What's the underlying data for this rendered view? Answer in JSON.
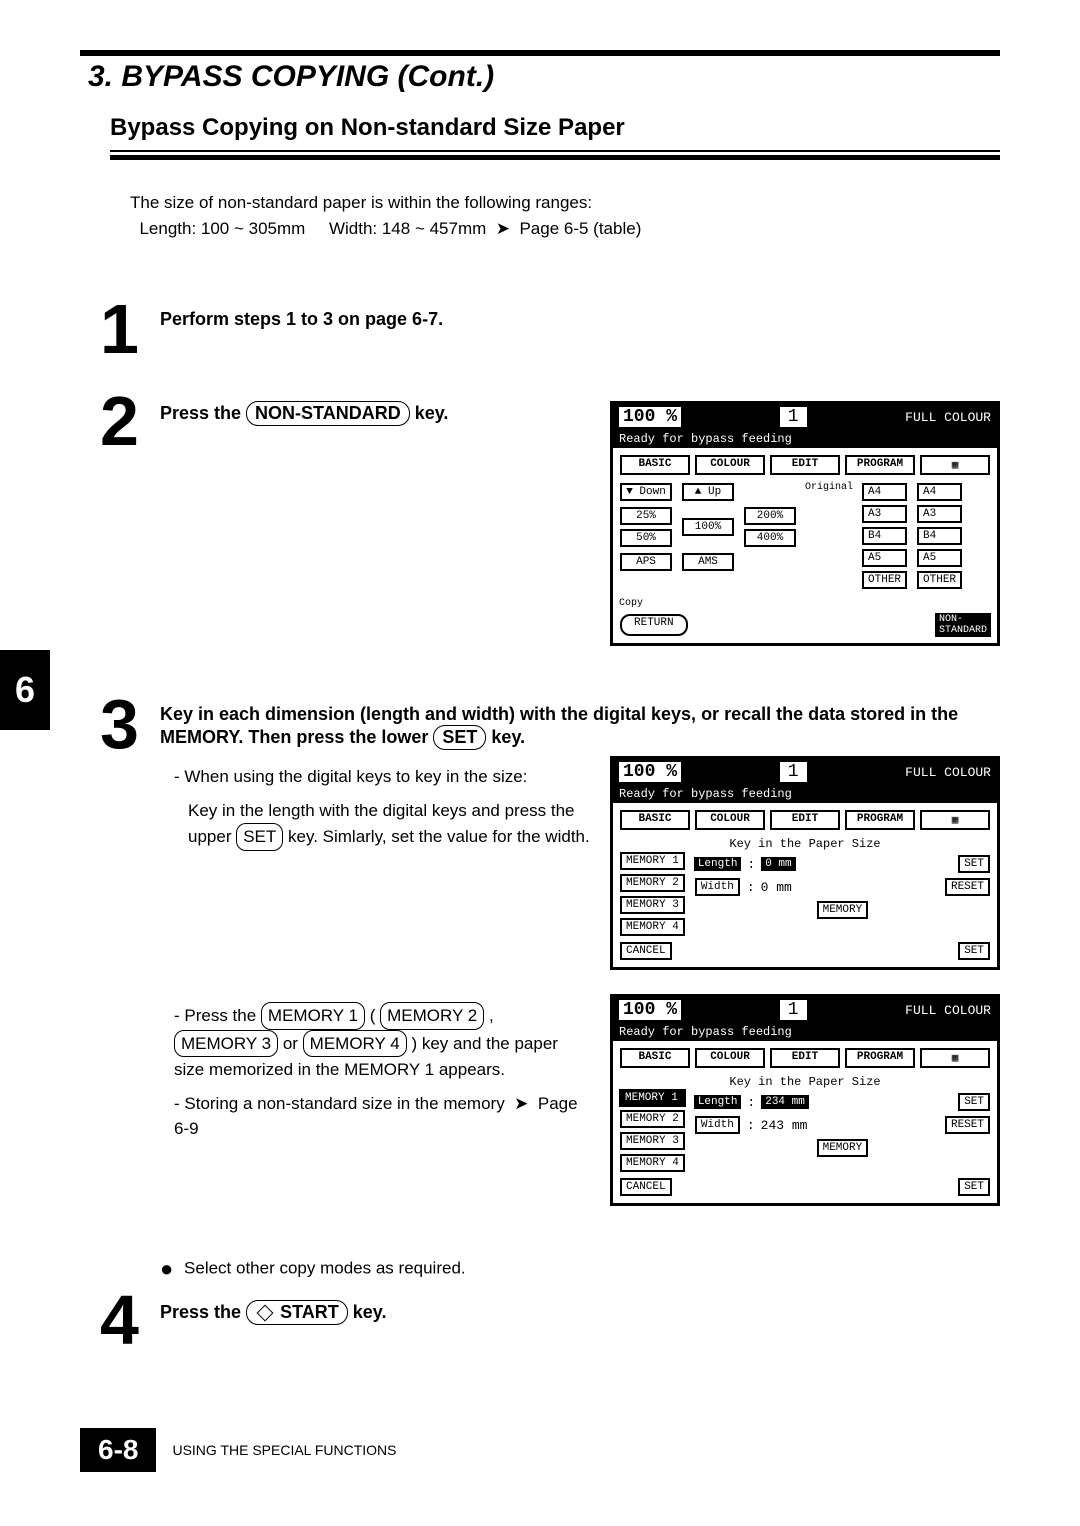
{
  "header": {
    "title": "3. BYPASS COPYING (Cont.)"
  },
  "subtitle": "Bypass Copying on Non-standard Size Paper",
  "intro": {
    "line1": "The size of non-standard paper is within the following ranges:",
    "line2a": "Length: 100 ~ 305mm",
    "line2b": "Width: 148 ~ 457mm",
    "pageref": "Page 6-5 (table)"
  },
  "sidebar_chapter": "6",
  "steps": {
    "s1": {
      "num": "1",
      "text": "Perform steps 1 to 3 on page 6-7."
    },
    "s2": {
      "num": "2",
      "text_a": "Press the ",
      "key": "NON-STANDARD",
      "text_b": " key."
    },
    "s3": {
      "num": "3",
      "line1": "Key in each dimension (length and width) with the digital keys, or recall the data stored in the MEMORY. Then press the lower ",
      "key": "SET",
      "line1b": " key.",
      "sub1a": "- When using the digital keys to key in the size:",
      "sub1b_a": "Key in the length with the digital keys and press the upper ",
      "sub1b_key": "SET",
      "sub1b_b": " key.  Simlarly, set the value for the width.",
      "sub2a_a": "- Press the ",
      "mem1": "MEMORY 1",
      "sub2a_b": " ( ",
      "mem2": "MEMORY 2",
      "sub2a_c": ", ",
      "mem3": "MEMORY 3",
      "sub2a_d": " or ",
      "mem4": "MEMORY 4",
      "sub2a_e": " ) key and the paper size memorized in the MEMORY 1 appears.",
      "sub2b": "- Storing a non-standard size in the memory",
      "sub2b_ref": "Page 6-9"
    },
    "note": "Select other copy modes as required.",
    "s4": {
      "num": "4",
      "text_a": "Press the ",
      "key": "START",
      "text_b": " key."
    }
  },
  "screens": {
    "common": {
      "pct": "100 %",
      "one": "1",
      "fullcolour": "FULL COLOUR",
      "msg": "Ready for bypass feeding",
      "tabs": [
        "BASIC",
        "COLOUR",
        "EDIT",
        "PROGRAM"
      ]
    },
    "a": {
      "down": "▼ Down",
      "up": "▲ Up",
      "p25": "25%",
      "p100": "100%",
      "p200": "200%",
      "p50": "50%",
      "p400": "400%",
      "aps": "APS",
      "ams": "AMS",
      "sizes_l": [
        "A4",
        "A3",
        "B4",
        "A5"
      ],
      "sizes_r": [
        "A4",
        "A3",
        "B4",
        "A5"
      ],
      "other": "OTHER",
      "original": "Original",
      "copy": "Copy",
      "return": "RETURN",
      "nonstd": "NON-\nSTANDARD"
    },
    "b": {
      "keyin": "Key in the Paper Size",
      "mem": [
        "MEMORY 1",
        "MEMORY 2",
        "MEMORY 3",
        "MEMORY 4"
      ],
      "length": "Length",
      "width": "Width",
      "lenval": "0 mm",
      "widval": "0 mm",
      "set": "SET",
      "reset": "RESET",
      "memory": "MEMORY",
      "cancel": "CANCEL",
      "set2": "SET"
    },
    "c": {
      "keyin": "Key in the Paper Size",
      "mem": [
        "MEMORY 1",
        "MEMORY 2",
        "MEMORY 3",
        "MEMORY 4"
      ],
      "length": "Length",
      "width": "Width",
      "lenval": "234 mm",
      "widval": "243 mm",
      "set": "SET",
      "reset": "RESET",
      "memory": "MEMORY",
      "cancel": "CANCEL",
      "set2": "SET"
    }
  },
  "footer": {
    "page": "6-8",
    "label": "USING THE SPECIAL FUNCTIONS"
  }
}
